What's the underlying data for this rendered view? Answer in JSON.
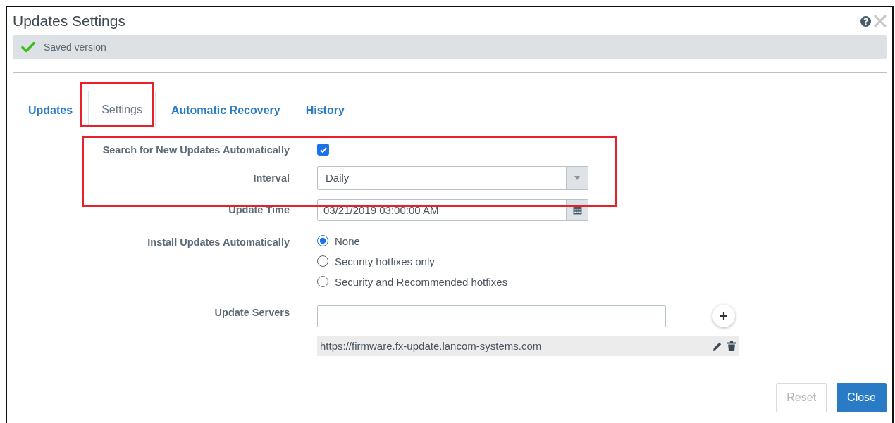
{
  "window": {
    "title": "Updates Settings"
  },
  "status": {
    "text": "Saved version"
  },
  "tabs": [
    {
      "label": "Updates",
      "selected": false
    },
    {
      "label": "Settings",
      "selected": true
    },
    {
      "label": "Automatic Recovery",
      "selected": false
    },
    {
      "label": "History",
      "selected": false
    }
  ],
  "form": [
    {
      "kind": "checkbox",
      "label": "Search for New Updates Automatically",
      "checked": true
    },
    {
      "kind": "select",
      "label": "Interval",
      "value": "Daily"
    },
    {
      "kind": "date",
      "label": "Update Time",
      "value": "03/21/2019 03:00:00 AM"
    },
    {
      "kind": "radio",
      "label": "Install Updates Automatically",
      "options": [
        {
          "label": "None",
          "selected": true
        },
        {
          "label": "Security hotfixes only",
          "selected": false
        },
        {
          "label": "Security and Recommended hotfixes",
          "selected": false
        }
      ]
    },
    {
      "kind": "servers",
      "label": "Update Servers",
      "servers": [
        "https://firmware.fx-update.lancom-systems.com"
      ]
    }
  ],
  "buttons": [
    {
      "label": "Reset",
      "disabled": true
    },
    {
      "label": "Close",
      "disabled": false
    }
  ]
}
